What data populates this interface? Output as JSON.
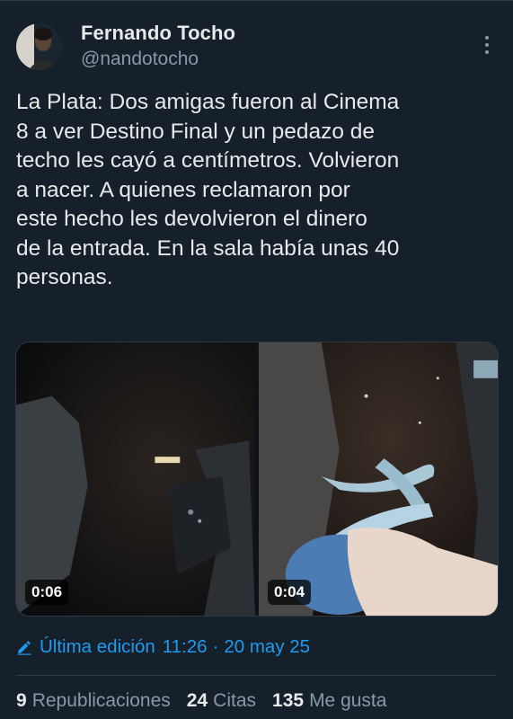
{
  "author": {
    "name": "Fernando Tocho",
    "handle": "@nandotocho"
  },
  "tweet": {
    "text": "La Plata: Dos amigas fueron al Cinema\n8 a ver Destino Final y un pedazo de\ntecho les cayó a centímetros. Volvieron\na nacer. A quienes reclamaron por\neste hecho les devolvieron el dinero\nde la entrada. En la sala había unas 40\npersonas."
  },
  "media": {
    "videos": [
      {
        "duration": "0:06"
      },
      {
        "duration": "0:04"
      }
    ]
  },
  "edited": {
    "label": "Última edición",
    "time": "11:26",
    "separator": "·",
    "date": "20 may 25"
  },
  "stats": {
    "reposts_count": "9",
    "reposts_label": "Republicaciones",
    "quotes_count": "24",
    "quotes_label": "Citas",
    "likes_count": "135",
    "likes_label": "Me gusta"
  },
  "icons": {
    "more": "more-vertical-icon",
    "edit": "pencil-icon"
  },
  "colors": {
    "background": "#15202b",
    "accent": "#1d9bf0",
    "text": "#e7e9ea",
    "muted": "#8b98a5"
  }
}
